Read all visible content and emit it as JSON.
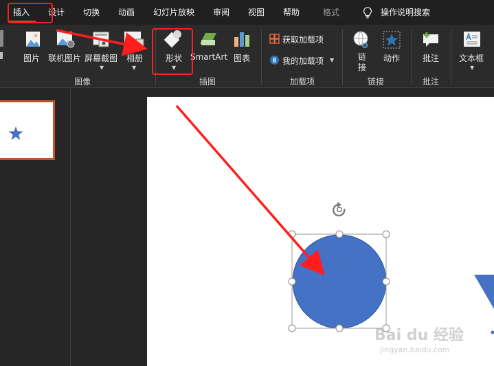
{
  "tabs": [
    {
      "label": "插入",
      "state": "active"
    },
    {
      "label": "设计",
      "state": "normal"
    },
    {
      "label": "切换",
      "state": "normal"
    },
    {
      "label": "动画",
      "state": "normal"
    },
    {
      "label": "幻灯片放映",
      "state": "normal"
    },
    {
      "label": "审阅",
      "state": "normal"
    },
    {
      "label": "视图",
      "state": "normal"
    },
    {
      "label": "帮助",
      "state": "normal"
    },
    {
      "label": "格式",
      "state": "muted"
    }
  ],
  "tell_me": {
    "label": "操作说明搜索",
    "icon": "lightbulb-icon"
  },
  "ribbon": {
    "images_group": {
      "label": "图像",
      "buttons": [
        {
          "label": "图片",
          "icon": "picture-icon"
        },
        {
          "label": "联机图片",
          "icon": "online-picture-icon"
        },
        {
          "label": "屏幕截图",
          "icon": "screenshot-icon",
          "has_dropdown": true
        },
        {
          "label": "相册",
          "icon": "photo-album-icon",
          "has_dropdown": true
        }
      ]
    },
    "illustrations_group": {
      "label": "插图",
      "buttons": [
        {
          "label": "形状",
          "icon": "shapes-icon",
          "has_dropdown": true
        },
        {
          "label": "SmartArt",
          "icon": "smartart-icon"
        },
        {
          "label": "图表",
          "icon": "chart-icon"
        }
      ]
    },
    "addins_group": {
      "label": "加载项",
      "buttons": [
        {
          "label": "获取加载项",
          "icon": "store-icon"
        },
        {
          "label": "我的加载项",
          "icon": "my-addins-icon",
          "has_dropdown": true
        }
      ]
    },
    "links_group": {
      "label": "链接",
      "buttons": [
        {
          "label": "链\n接",
          "icon": "link-icon"
        },
        {
          "label": "动作",
          "icon": "action-icon"
        }
      ]
    },
    "comments_group": {
      "label": "批注",
      "buttons": [
        {
          "label": "批注",
          "icon": "comment-icon"
        }
      ]
    },
    "text_group": {
      "buttons": [
        {
          "label": "文本框",
          "icon": "textbox-icon",
          "has_dropdown": true
        }
      ]
    }
  },
  "colors": {
    "accent": "#d24726",
    "annotation": "#ff1e1e",
    "shape_fill": "#4472c4",
    "shape_stroke": "#2f5597"
  },
  "watermark": {
    "text": "Bai du 经验",
    "url": "jingyan.baidu.com"
  }
}
